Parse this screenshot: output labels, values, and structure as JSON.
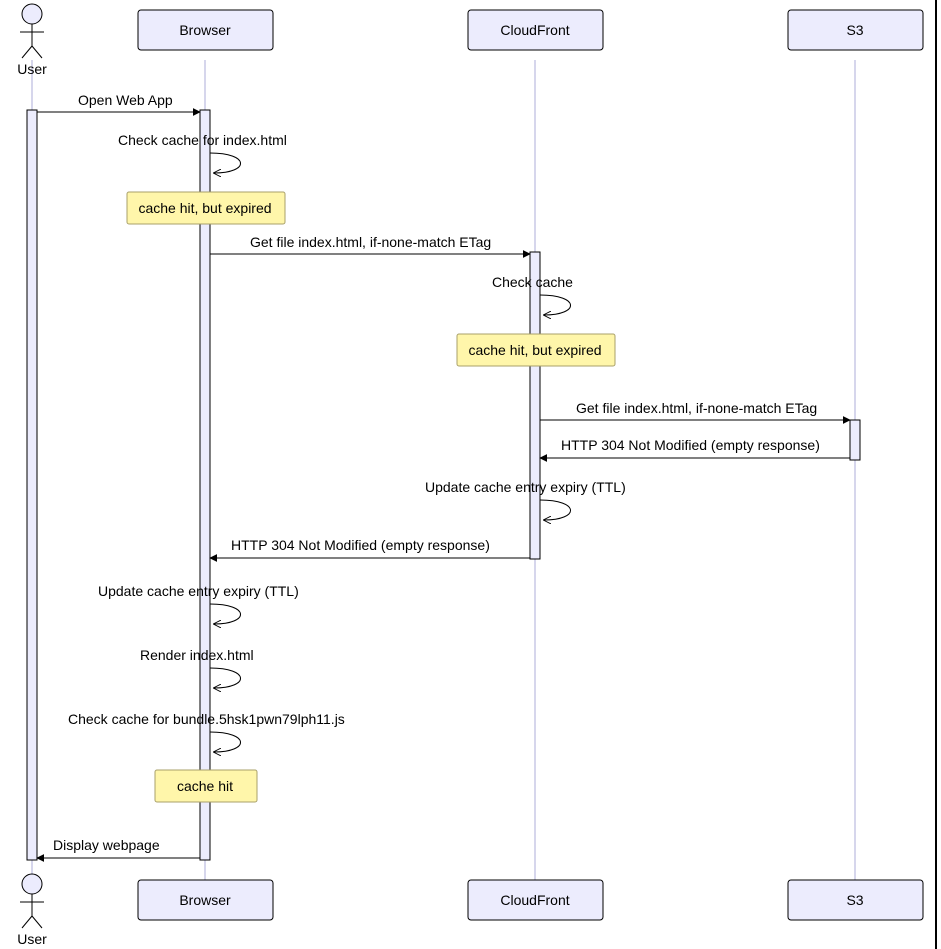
{
  "participants": {
    "user": "User",
    "browser": "Browser",
    "cloudfront": "CloudFront",
    "s3": "S3"
  },
  "messages": {
    "m1": "Open Web App",
    "m2": "Check cache for index.html",
    "m3": "Get file index.html, if-none-match ETag",
    "m4": "Check cache",
    "m5": "Get file index.html, if-none-match ETag",
    "m6": "HTTP 304 Not Modified (empty response)",
    "m7": "Update cache entry expiry (TTL)",
    "m8": "HTTP 304 Not Modified (empty response)",
    "m9": "Update cache entry expiry (TTL)",
    "m10": "Render index.html",
    "m11": "Check cache for bundle.5hsk1pwn79lph11.js",
    "m12": "Display webpage"
  },
  "notes": {
    "n1": "cache hit, but expired",
    "n2": "cache hit, but expired",
    "n3": "cache hit"
  }
}
